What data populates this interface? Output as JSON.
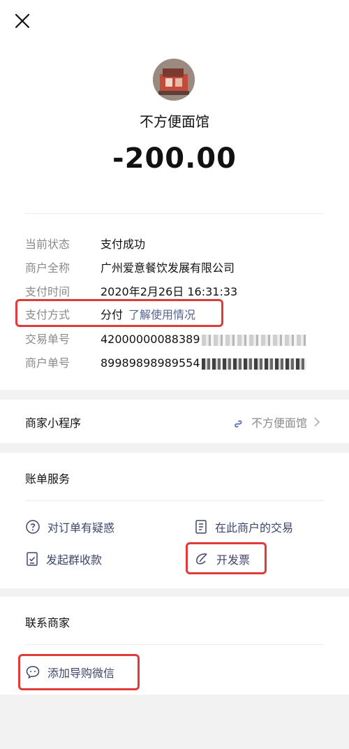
{
  "header": {
    "close_icon": "close-icon"
  },
  "merchant": {
    "name": "不方便面馆",
    "amount": "-200.00"
  },
  "details": {
    "status": {
      "label": "当前状态",
      "value": "支付成功"
    },
    "merchant_full": {
      "label": "商户全称",
      "value": "广州爱意餐饮发展有限公司"
    },
    "pay_time": {
      "label": "支付时间",
      "value": "2020年2月26日 16:31:33"
    },
    "pay_method": {
      "label": "支付方式",
      "value": "分付",
      "link": "了解使用情况"
    },
    "txn_no": {
      "label": "交易单号",
      "value": "42000000088389"
    },
    "merchant_no": {
      "label": "商户单号",
      "value": "89989898989554"
    }
  },
  "mini_program": {
    "label": "商家小程序",
    "name": "不方便面馆"
  },
  "bill_service": {
    "title": "账单服务",
    "items": [
      {
        "label": "对订单有疑惑",
        "icon": "question-circle-icon"
      },
      {
        "label": "在此商户的交易",
        "icon": "document-icon"
      },
      {
        "label": "发起群收款",
        "icon": "checklist-icon"
      },
      {
        "label": "开发票",
        "icon": "invoice-leaf-icon"
      }
    ]
  },
  "contact": {
    "title": "联系商家",
    "wechat_label": "添加导购微信",
    "icon": "chat-bubble-icon"
  },
  "colors": {
    "link": "#56648f",
    "service_text": "#3c466a",
    "highlight": "#e03b3b",
    "label_gray": "#8a8a8a"
  }
}
